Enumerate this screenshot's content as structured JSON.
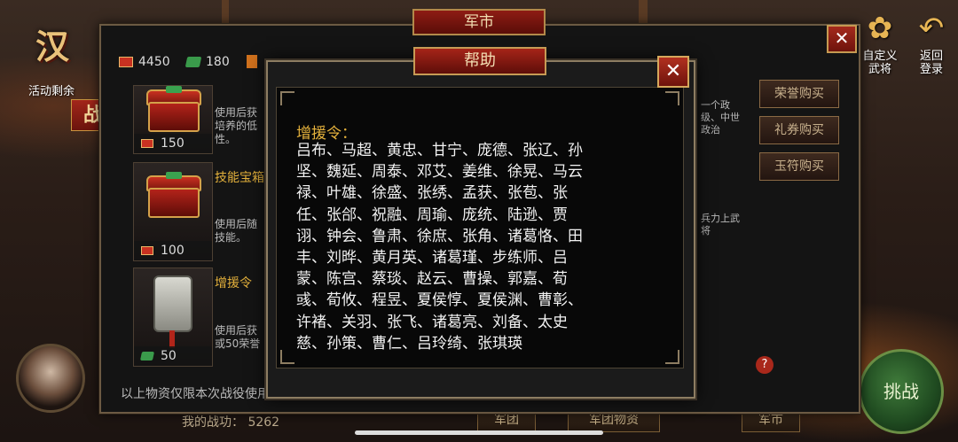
{
  "scene": {
    "title_glyph": "汉",
    "activity_label": "活动剩余",
    "tag_glyph": "战",
    "top_buttons": [
      {
        "label_line1": "自定义",
        "label_line2": "武将",
        "icon": "seal-icon"
      },
      {
        "label_line1": "返回",
        "label_line2": "登录",
        "icon": "return-arrow-icon"
      }
    ],
    "challenge_label": "挑战",
    "bottom_buttons": [
      "军团",
      "军团物资",
      "军市"
    ],
    "power_label": "我的战功：",
    "power_value": "5262"
  },
  "market": {
    "title": "军市",
    "close_label": "✕",
    "currencies": [
      {
        "icon": "honor-coin-icon",
        "value": "4450"
      },
      {
        "icon": "voucher-icon",
        "value": "180"
      },
      {
        "icon": "jade-token-icon",
        "value": ""
      }
    ],
    "items": [
      {
        "name": "",
        "desc": "使用后获培养的低性。",
        "price": "150",
        "icon": "chest-icon"
      },
      {
        "name": "技能宝箱",
        "desc": "使用后随技能。",
        "price": "100",
        "icon": "chest-icon"
      },
      {
        "name": "增援令",
        "desc": "使用后获或50荣誉",
        "price": "50",
        "icon": "token-icon"
      }
    ],
    "right_texts": [
      "一个政级、中世政治",
      "兵力上武将"
    ],
    "side_buttons": [
      "荣誉购买",
      "礼券购买",
      "玉符购买"
    ],
    "help_button": "?",
    "footer_note": "以上物资仅限本次战役使用，战役结束后会自动移除。"
  },
  "help": {
    "title": "帮助",
    "close_label": "✕",
    "heading": "增援令：",
    "lines": [
      "吕布、马超、黄忠、甘宁、庞德、张辽、孙",
      "坚、魏延、周泰、邓艾、姜维、徐晃、马云",
      "禄、叶雄、徐盛、张绣、孟获、张苞、张",
      "任、张郃、祝融、周瑜、庞统、陆逊、贾",
      "诩、钟会、鲁肃、徐庶、张角、诸葛恪、田",
      "丰、刘晔、黄月英、诸葛瑾、步练师、吕",
      "蒙、陈宫、蔡琰、赵云、曹操、郭嘉、荀",
      "彧、荀攸、程昱、夏侯惇、夏侯渊、曹彰、",
      "许褚、关羽、张飞、诸葛亮、刘备、太史",
      "慈、孙策、曹仁、吕玲绮、张琪瑛"
    ]
  }
}
